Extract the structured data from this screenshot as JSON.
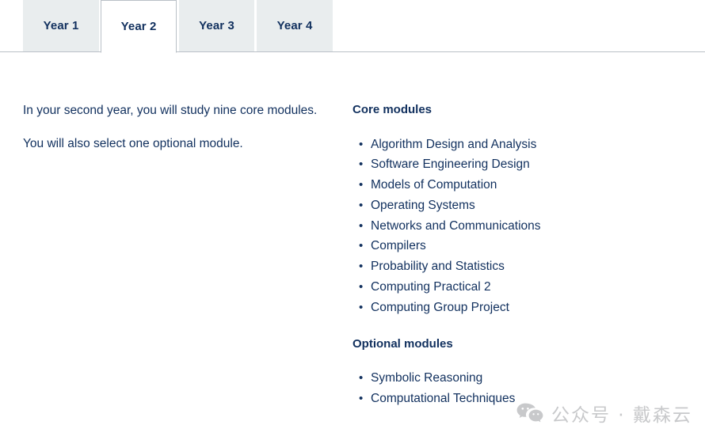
{
  "tabs": {
    "items": [
      {
        "label": "Year 1",
        "active": false
      },
      {
        "label": "Year 2",
        "active": true
      },
      {
        "label": "Year 3",
        "active": false
      },
      {
        "label": "Year 4",
        "active": false
      }
    ]
  },
  "panel": {
    "intro": [
      "In your second year, you will study nine core modules.",
      "You will also select one optional module."
    ],
    "groups": [
      {
        "heading": "Core modules",
        "modules": [
          "Algorithm Design and Analysis",
          "Software Engineering Design",
          "Models of Computation",
          "Operating Systems",
          "Networks and Communications",
          "Compilers",
          "Probability and Statistics",
          "Computing Practical 2",
          "Computing Group Project"
        ]
      },
      {
        "heading": "Optional modules",
        "modules": [
          "Symbolic Reasoning",
          "Computational Techniques"
        ]
      }
    ]
  },
  "watermark": {
    "icon": "wechat-icon",
    "text": "公众号 · 戴森云",
    "color": "#c8c9cb"
  },
  "colors": {
    "text_navy": "#11305e",
    "tab_inactive_bg": "#e9edee",
    "tab_active_bg": "#ffffff",
    "rule": "#b9c0c7",
    "page_bg": "#ffffff"
  }
}
